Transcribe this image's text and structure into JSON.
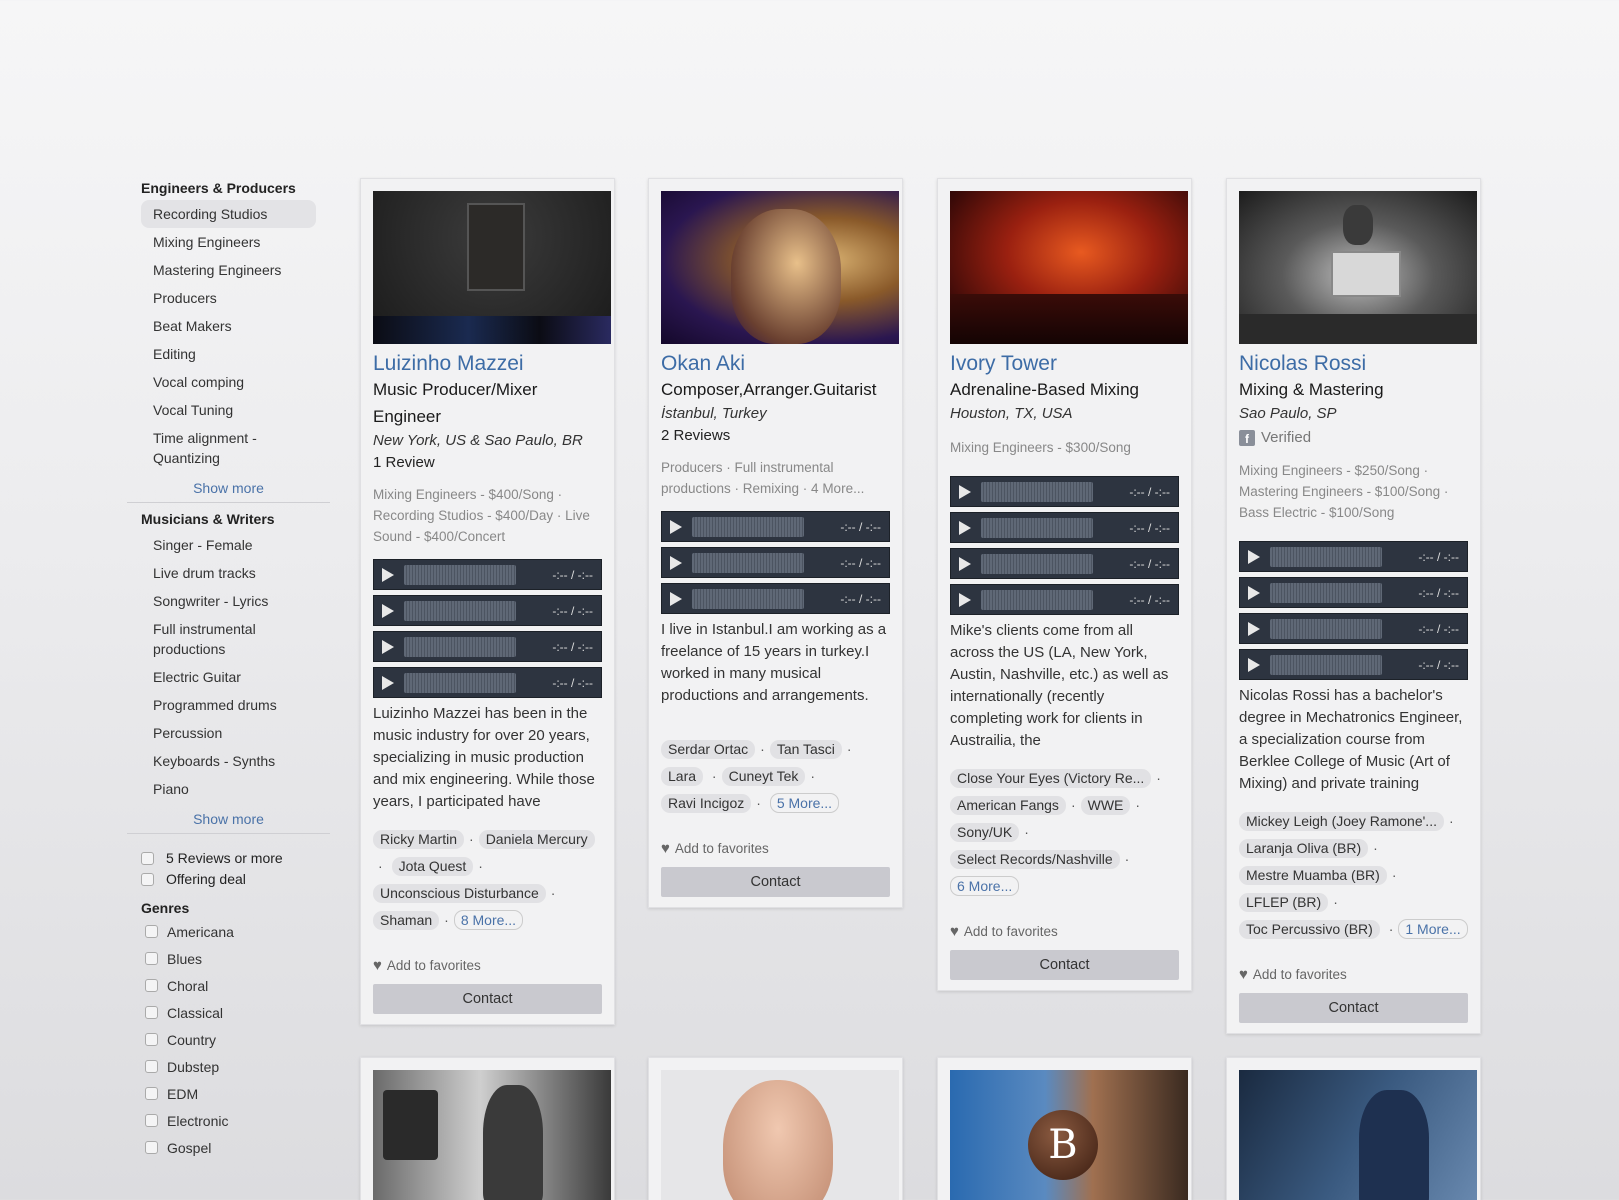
{
  "sidebar": {
    "engineers_heading": "Engineers & Producers",
    "engineers": [
      "Recording Studios",
      "Mixing Engineers",
      "Mastering Engineers",
      "Producers",
      "Beat Makers",
      "Editing",
      "Vocal comping",
      "Vocal Tuning",
      "Time alignment - Quantizing"
    ],
    "show_more_1": "Show more",
    "musicians_heading": "Musicians & Writers",
    "musicians": [
      "Singer - Female",
      "Live drum tracks",
      "Songwriter - Lyrics",
      "Full instrumental productions",
      "Electric Guitar",
      "Programmed drums",
      "Percussion",
      "Keyboards - Synths",
      "Piano"
    ],
    "show_more_2": "Show more",
    "filters": [
      "5 Reviews or more",
      "Offering deal"
    ],
    "genres_heading": "Genres",
    "genres": [
      "Americana",
      "Blues",
      "Choral",
      "Classical",
      "Country",
      "Dubstep",
      "EDM",
      "Electronic",
      "Gospel"
    ]
  },
  "player_time": "-:-- / -:--",
  "add_to_favorites": "Add to favorites",
  "contact": "Contact",
  "cards": [
    {
      "name": "Luizinho Mazzei",
      "title": "Music Producer/Mixer Engineer",
      "location": "New York, US & Sao Paulo, BR",
      "reviews": "1 Review",
      "services": "Mixing Engineers - $400/Song · Recording Studios - $400/Day · Live Sound - $400/Concert",
      "bio": "Luizinho Mazzei has been in the music industry for over 20 years, specializing in music production and mix engineering. While those years, I participated have",
      "tags": [
        "Ricky Martin",
        "Daniela Mercury",
        "Jota Quest",
        "Unconscious Disturbance",
        "Shaman"
      ],
      "more": "8 More..."
    },
    {
      "name": "Okan Aki",
      "title": "Composer,Arranger.Guitarist",
      "location": "İstanbul, Turkey",
      "reviews": "2 Reviews",
      "services": "Producers · Full instrumental productions · Remixing · 4 More...",
      "bio": "I live in Istanbul.I am working as a freelance of 15 years in turkey.I worked in many musical productions and arrangements.",
      "tags": [
        "Serdar Ortac",
        "Tan Tasci",
        "Lara",
        "Cuneyt Tek",
        "Ravi Incigoz"
      ],
      "more": "5 More..."
    },
    {
      "name": "Ivory Tower",
      "title": "Adrenaline-Based Mixing",
      "location": "Houston, TX, USA",
      "services": "Mixing Engineers - $300/Song",
      "bio": "Mike's clients come from all across the US (LA, New York, Austin, Nashville, etc.) as well as internationally (recently completing work for clients in Austrailia, the",
      "tags": [
        "Close Your Eyes (Victory Re...",
        "American Fangs",
        "WWE",
        "Sony/UK",
        "Select Records/Nashville"
      ],
      "more": "6 More..."
    },
    {
      "name": "Nicolas Rossi",
      "title": "Mixing & Mastering",
      "location": "Sao Paulo, SP",
      "verified": "Verified",
      "services": "Mixing Engineers - $250/Song · Mastering Engineers - $100/Song · Bass Electric - $100/Song",
      "bio": "Nicolas Rossi has a bachelor's degree in Mechatronics Engineer, a specialization course from Berklee College of Music (Art of Mixing) and private training",
      "tags": [
        "Mickey Leigh (Joey Ramone'...",
        "Laranja Oliva (BR)",
        "Mestre Muamba (BR)",
        "LFLEP (BR)",
        "Toc Percussivo (BR)"
      ],
      "more": "1 More..."
    }
  ],
  "photo_letter": "B"
}
